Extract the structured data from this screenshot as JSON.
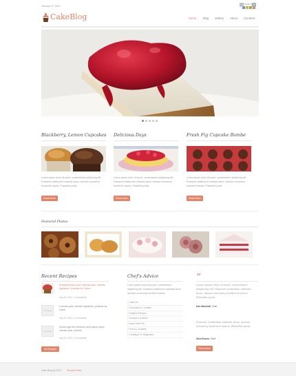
{
  "header": {
    "date": "January 13, 2012",
    "choose_color_label": "Choose color",
    "logo_text": "CakeBlog",
    "color_swatches": [
      "#6a8fd0",
      "#f2a33a",
      "#7dbb4a",
      "#e0846a"
    ],
    "social_icons": [
      "twitter-icon",
      "facebook-icon"
    ]
  },
  "nav": {
    "items": [
      "Home",
      "Blog",
      "Gallery",
      "About",
      "Contacts"
    ],
    "active": "Home",
    "accent": "#e0846a"
  },
  "slider": {
    "slides": 5,
    "active_slide": 1
  },
  "features": [
    {
      "title": "Blackberry, Lemon Cupcakes",
      "text": "Lorem ipsum dolor sit amet, consectetuer adipiscing elit. Praesent vestibulum molestie lacus. Aenean nonummy hendrerit mauris. Phasellus porta.",
      "button": "Read More"
    },
    {
      "title": "Delicious Days",
      "text": "Lorem ipsum dolor sit amet, consectetuer adipiscing elit. Praesent vestibulum molestie lacus. Aenean nonummy hendrerit mauris. Phasellus porta.",
      "button": "Read More"
    },
    {
      "title": "Fresh Fig  Cupcake Bombe",
      "text": "Lorem ipsum dolor sit amet, consectetuer adipiscing elit. Praesent vestibulum molestie lacus. Aenean nonummy hendrerit mauris. Phasellus porta.",
      "button": "Read More"
    }
  ],
  "featured_photos": {
    "title": "Featured Photos",
    "count": 5
  },
  "recent_recipes": {
    "title": "Recent Recipes",
    "items": [
      {
        "text": "Praesent justo dolor, lobortis quis, lobortis dignissim, pulvinar ac, lorem",
        "meta": "July 29, 2011 / 0 Comments",
        "no_image": ""
      },
      {
        "text": "Lobortis quis, lobortis dignissim, pulvinar ac, lorem",
        "meta": "July 29, 2011 / 0 Comments",
        "no_image": "No image"
      },
      {
        "text": "Donec sgit fibo ferribum anet ipsum dolor, lobortis quis, lobortis",
        "meta": "July 29, 2011 / 0 Comments",
        "no_image": "No image"
      }
    ],
    "button": "All Recipes"
  },
  "chefs_advice": {
    "title": "Chef's Advice",
    "intro": "Lorem ipsum dolor sit amet, consectetuer adipiscing elit. Praesent vestibulum molestie lacus. Aenean nonummy hendrerit mauris.",
    "items": [
      "Cake Art",
      "Chocolate & Candies",
      "Healthy Recipes",
      "Occasion & Ideas",
      "Ideas With Pie",
      "Fruit & Cocktails",
      "Creating For Beginners"
    ]
  },
  "testimonials": {
    "quote_mark": "“",
    "items": [
      {
        "text": "Lorem ipsum dolor sit amet, consectetuer adipiscing elit. Praesent vestibulum molestie lacus. Aenean nonummy hendrerit mauris. Phasellus porta.",
        "author": "Dan Marshall",
        "role": "Chef"
      },
      {
        "text": "Praesent vestibulum molestie lacus. Aenean nonummy hendrerit mauris. Phasellus porta.",
        "author": "Sara Brown",
        "role": "Chef"
      }
    ],
    "button": "Read More"
  },
  "footer": {
    "copyright": "Cake Blog (c) 2012",
    "privacy": "Privacy Policy"
  }
}
